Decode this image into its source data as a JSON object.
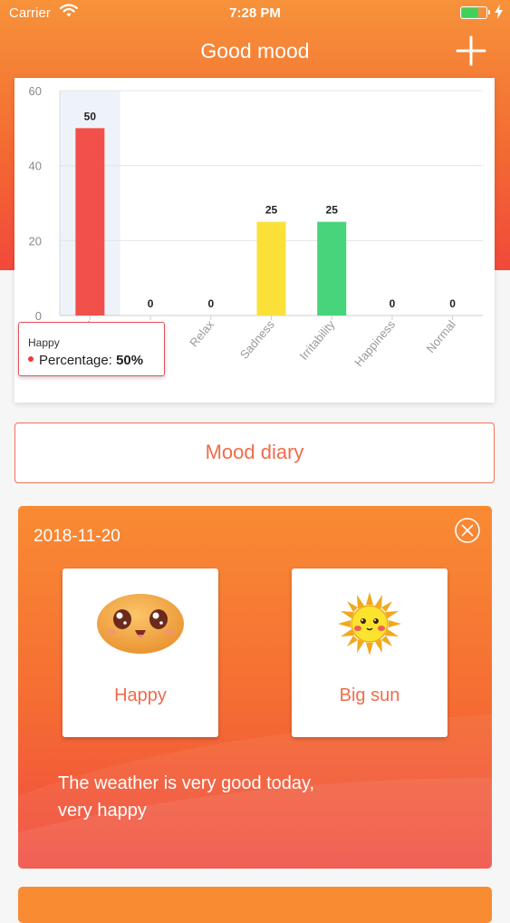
{
  "status_bar": {
    "carrier": "Carrier",
    "time": "7:28 PM",
    "battery_level": 0.7
  },
  "nav": {
    "title": "Good mood"
  },
  "chart_data": {
    "type": "bar",
    "categories": [
      "Happy",
      "Relaxation",
      "Relax",
      "Sadness",
      "Irritability",
      "Happiness",
      "Normal"
    ],
    "values": [
      50,
      0,
      0,
      25,
      25,
      0,
      0
    ],
    "colors": [
      "#f2504b",
      "#f2504b",
      "#f2504b",
      "#fbe03a",
      "#47d47a",
      "#f2504b",
      "#f2504b"
    ],
    "highlighted_index": 0,
    "yticks": [
      0,
      20,
      40,
      60
    ],
    "ylim": [
      0,
      60
    ],
    "grid": true,
    "show_value_labels": true,
    "tooltip": {
      "title": "Happy",
      "label": "Percentage:",
      "value": "50%"
    }
  },
  "diary": {
    "button_label": "Mood diary"
  },
  "entry": {
    "date": "2018-11-20",
    "mood_label": "Happy",
    "weather_label": "Big sun",
    "note_line1": "The weather is very good today,",
    "note_line2": "very happy"
  }
}
